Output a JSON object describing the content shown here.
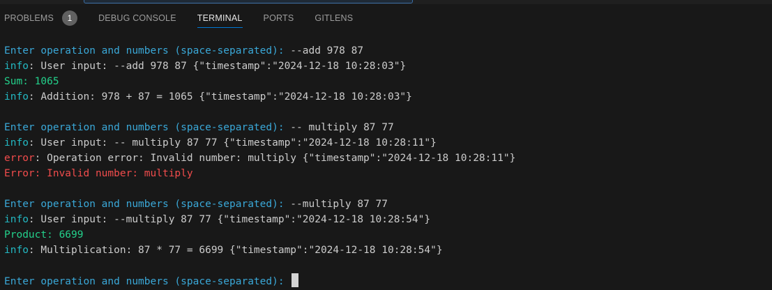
{
  "panel": {
    "tabs": [
      {
        "label": "PROBLEMS",
        "badge": "1"
      },
      {
        "label": "DEBUG CONSOLE"
      },
      {
        "label": "TERMINAL",
        "active": true
      },
      {
        "label": "PORTS"
      },
      {
        "label": "GITLENS"
      }
    ]
  },
  "colors": {
    "prompt": "#3aa8d8",
    "info": "#23b8c2",
    "error": "#f14c4c",
    "result": "#23d18b",
    "text": "#cccccc",
    "active_tab_underline": "#0078d4"
  },
  "terminal": {
    "lines": [
      {
        "prompt": "Enter operation and numbers (space-separated):",
        "input": " --add 978 87"
      },
      {
        "level": "info",
        "text": ": User input: --add 978 87 {\"timestamp\":\"2024-12-18 10:28:03\"}"
      },
      {
        "output": "Sum: 1065"
      },
      {
        "level": "info",
        "text": ": Addition: 978 + 87 = 1065 {\"timestamp\":\"2024-12-18 10:28:03\"}"
      },
      {
        "blank": true
      },
      {
        "prompt": "Enter operation and numbers (space-separated):",
        "input": " -- multiply 87 77"
      },
      {
        "level": "info",
        "text": ": User input: -- multiply 87 77 {\"timestamp\":\"2024-12-18 10:28:11\"}"
      },
      {
        "level": "error",
        "text": ": Operation error: Invalid number: multiply {\"timestamp\":\"2024-12-18 10:28:11\"}"
      },
      {
        "error_output": "Error: Invalid number: multiply"
      },
      {
        "blank": true
      },
      {
        "prompt": "Enter operation and numbers (space-separated):",
        "input": " --multiply 87 77"
      },
      {
        "level": "info",
        "text": ": User input: --multiply 87 77 {\"timestamp\":\"2024-12-18 10:28:54\"}"
      },
      {
        "output": "Product: 6699"
      },
      {
        "level": "info",
        "text": ": Multiplication: 87 * 77 = 6699 {\"timestamp\":\"2024-12-18 10:28:54\"}"
      },
      {
        "blank": true
      },
      {
        "prompt": "Enter operation and numbers (space-separated):",
        "input": " ",
        "cursor": true
      }
    ]
  }
}
